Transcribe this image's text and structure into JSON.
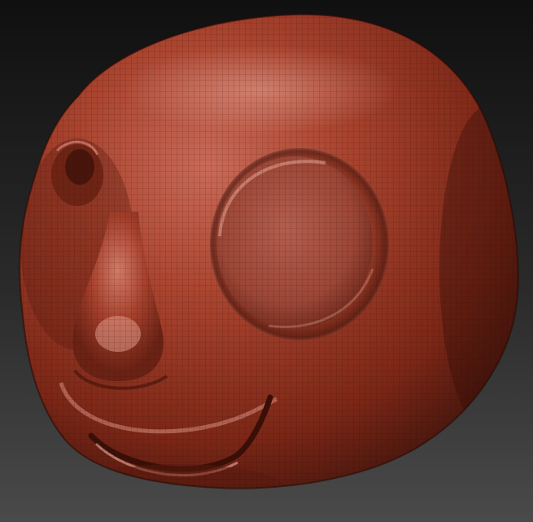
{
  "viewport": {
    "background_top": "#101010",
    "background_bottom": "#4a4a4a"
  },
  "model": {
    "material_color": "#a8432f",
    "highlight_color": "#d98a7c",
    "shadow_color": "#3e140c",
    "wireframe_visible": true
  }
}
